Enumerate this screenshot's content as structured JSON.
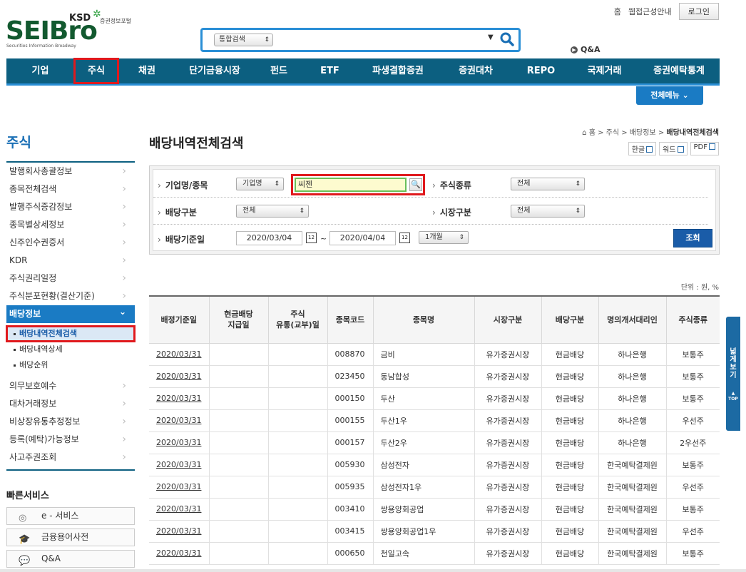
{
  "top_links": {
    "home": "홈",
    "accessibility": "웹접근성안내",
    "login": "로그인"
  },
  "logo": {
    "brand": "SEIBro",
    "ksd": "KSD",
    "portal": "증권정보포털",
    "subtitle": "Securities Information Broadway"
  },
  "search": {
    "type_label": "통합검색",
    "value": ""
  },
  "qna_top": "Q&A",
  "gnb": {
    "items": [
      "기업",
      "주식",
      "채권",
      "단기금융시장",
      "펀드",
      "ETF",
      "파생결합증권",
      "증권대차",
      "REPO",
      "국제거래",
      "증권예탁통계"
    ],
    "active": "주식",
    "all_menu": "전체메뉴"
  },
  "sidebar": {
    "title": "주식",
    "items_before": [
      "발행회사총괄정보",
      "종목전체검색",
      "발행주식증감정보",
      "종목별상세정보",
      "신주인수권증서",
      "KDR",
      "주식권리일정",
      "주식분포현황(결산기준)"
    ],
    "open_item": "배당정보",
    "sub_items": [
      "배당내역전체검색",
      "배당내역상세",
      "배당순위"
    ],
    "current_sub": "배당내역전체검색",
    "items_after": [
      "의무보호예수",
      "대차거래정보",
      "비상장유통추정정보",
      "등록(예탁)가능정보",
      "사고주권조회"
    ]
  },
  "quick": {
    "title": "빠른서비스",
    "buttons": [
      "e - 서비스",
      "금융용어사전",
      "Q&A"
    ]
  },
  "breadcrumb": {
    "home": "홈",
    "l1": "주식",
    "l2": "배당정보",
    "current": "배당내역전체검색"
  },
  "page_title": "배당내역전체검색",
  "downloads": {
    "hangul": "한글",
    "word": "워드",
    "pdf": "PDF"
  },
  "filter": {
    "company_label": "기업명/종목",
    "company_type": "기업명",
    "keyword": "씨젠",
    "stock_type_label": "주식종류",
    "stock_type": "전체",
    "dividend_type_label": "배당구분",
    "dividend_type": "전체",
    "market_label": "시장구분",
    "market": "전체",
    "date_label": "배당기준일",
    "date_from": "2020/03/04",
    "tilde": "~",
    "date_to": "2020/04/04",
    "period": "1개월",
    "search_button": "조회"
  },
  "unit": "단위 : 원, %",
  "table": {
    "headers": [
      "배정기준일",
      "현금배당\n지급일",
      "주식\n유통(교부)일",
      "종목코드",
      "종목명",
      "시장구분",
      "배당구분",
      "명의개서대리인",
      "주식종류"
    ],
    "rows": [
      [
        "2020/03/31",
        "",
        "",
        "008870",
        "금비",
        "유가증권시장",
        "현금배당",
        "하나은행",
        "보통주"
      ],
      [
        "2020/03/31",
        "",
        "",
        "023450",
        "동남합성",
        "유가증권시장",
        "현금배당",
        "하나은행",
        "보통주"
      ],
      [
        "2020/03/31",
        "",
        "",
        "000150",
        "두산",
        "유가증권시장",
        "현금배당",
        "하나은행",
        "보통주"
      ],
      [
        "2020/03/31",
        "",
        "",
        "000155",
        "두산1우",
        "유가증권시장",
        "현금배당",
        "하나은행",
        "우선주"
      ],
      [
        "2020/03/31",
        "",
        "",
        "000157",
        "두산2우",
        "유가증권시장",
        "현금배당",
        "하나은행",
        "2우선주"
      ],
      [
        "2020/03/31",
        "",
        "",
        "005930",
        "삼성전자",
        "유가증권시장",
        "현금배당",
        "한국예탁결제원",
        "보통주"
      ],
      [
        "2020/03/31",
        "",
        "",
        "005935",
        "삼성전자1우",
        "유가증권시장",
        "현금배당",
        "한국예탁결제원",
        "우선주"
      ],
      [
        "2020/03/31",
        "",
        "",
        "003410",
        "쌍용양회공업",
        "유가증권시장",
        "현금배당",
        "한국예탁결제원",
        "보통주"
      ],
      [
        "2020/03/31",
        "",
        "",
        "003415",
        "쌍용양회공업1우",
        "유가증권시장",
        "현금배당",
        "한국예탁결제원",
        "우선주"
      ],
      [
        "2020/03/31",
        "",
        "",
        "000650",
        "천일고속",
        "유가증권시장",
        "현금배당",
        "한국예탁결제원",
        "보통주"
      ]
    ]
  },
  "float": {
    "wide_view": "넓게보기",
    "top": "TOP"
  },
  "colors": {
    "nav": "#0c5f80",
    "accent": "#2a8fd6",
    "highlight": "#e0191d",
    "brand_green": "#12592f"
  }
}
